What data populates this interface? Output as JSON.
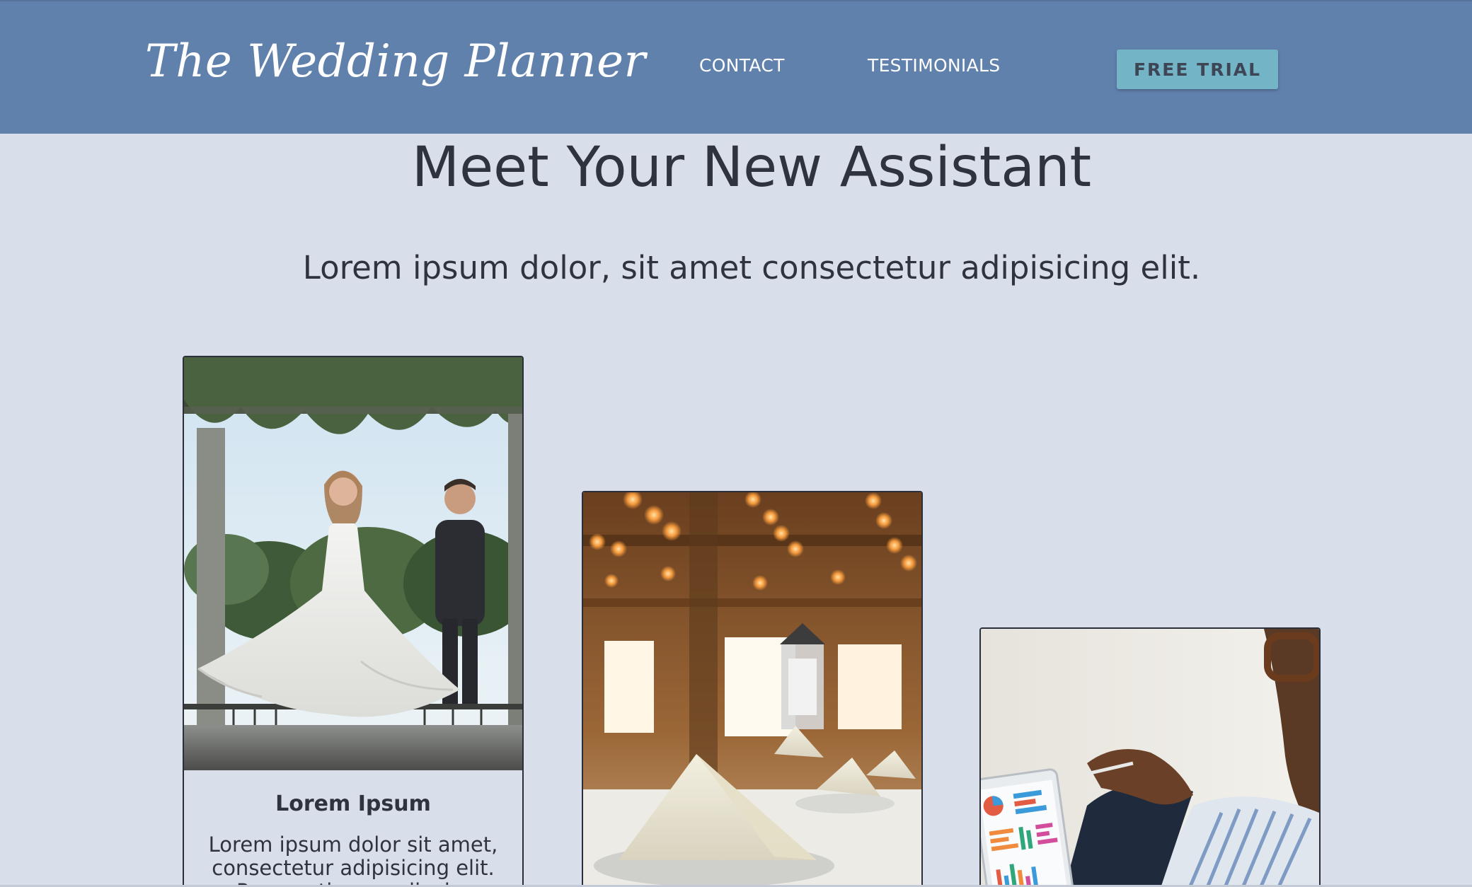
{
  "header": {
    "logo": "The Wedding Planner",
    "nav": [
      {
        "label": "CONTACT"
      },
      {
        "label": "TESTIMONIALS"
      }
    ],
    "cta_label": "FREE TRIAL"
  },
  "hero": {
    "title": "Meet Your New Assistant",
    "subtitle": "Lorem ipsum dolor, sit amet consectetur adipisicing elit."
  },
  "cards": [
    {
      "image": "wedding-couple-photo",
      "title": "Lorem Ipsum",
      "text": "Lorem ipsum dolor sit amet, consectetur adipisicing elit. Praesentium explicabo"
    },
    {
      "image": "banquet-table-napkins-photo"
    },
    {
      "image": "man-with-tablet-charts-photo"
    }
  ],
  "colors": {
    "header_bg": "#6181ad",
    "page_bg": "#d9dfea",
    "cta_bg": "#73b5c6",
    "text": "#2f3340"
  }
}
